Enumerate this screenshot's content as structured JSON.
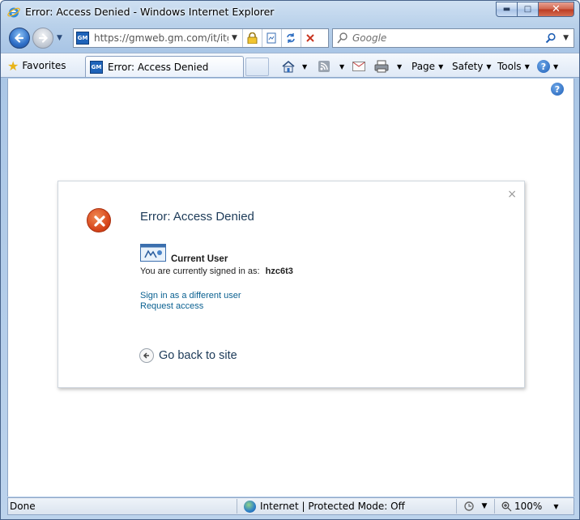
{
  "window": {
    "title": "Error: Access Denied - Windows Internet Explorer",
    "controls": {
      "minimize": "▬",
      "maximize": "□",
      "close": "✕"
    }
  },
  "navigation": {
    "url": "https://gmweb.gm.com/it/itgn",
    "site_icon_text": "GM",
    "search_placeholder": "Google"
  },
  "command_bar": {
    "favorites_label": "Favorites",
    "tab_label": "Error: Access Denied",
    "menus": [
      "Page",
      "Safety",
      "Tools"
    ]
  },
  "dialog": {
    "title": "Error: Access Denied",
    "close_glyph": "×",
    "current_user_heading": "Current User",
    "signed_in_text": "You are currently signed in as:",
    "user_id": "hzc6t3",
    "links": [
      "Sign in as a different user",
      "Request access"
    ],
    "go_back_label": "Go back to site"
  },
  "status_bar": {
    "status": "Done",
    "zone": "Internet | Protected Mode: Off",
    "zoom": "100%"
  },
  "icons": {
    "help": "?",
    "error": "x"
  },
  "colors": {
    "error_icon": "#d6441a",
    "link": "#0b6191",
    "heading": "#1c3a58"
  }
}
